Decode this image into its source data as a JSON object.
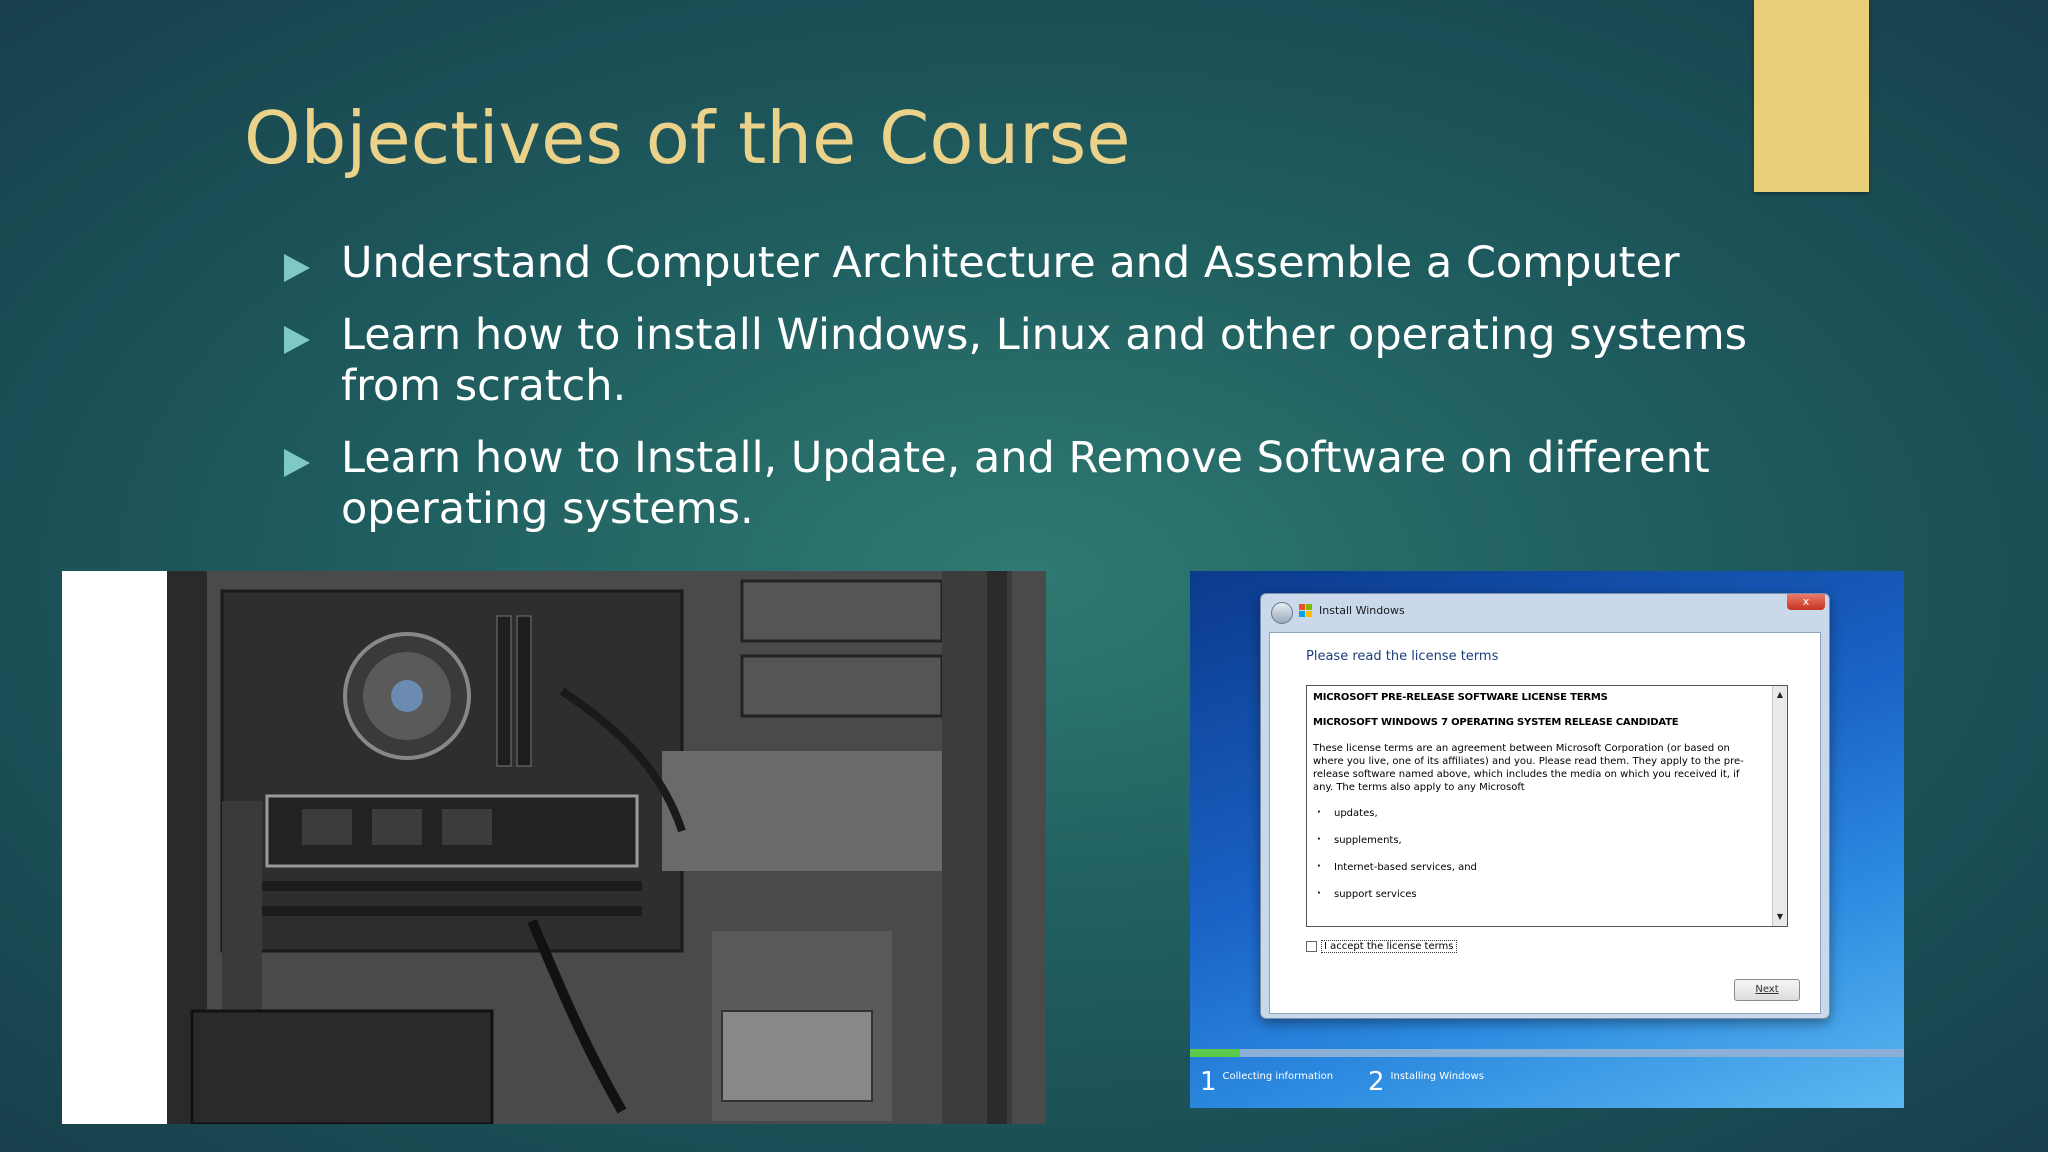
{
  "slide": {
    "title": "Objectives of the Course",
    "bullets": [
      "Understand Computer Architecture and Assemble a Computer",
      "Learn how to install Windows, Linux and other operating systems from scratch.",
      "Learn how to Install, Update, and Remove Software on different operating systems."
    ],
    "colors": {
      "title": "#ead28a",
      "accent": "#e9cf77",
      "bullet_arrow": "#7fc8c8"
    }
  },
  "installer": {
    "window_title": "Install Windows",
    "close_glyph": "x",
    "heading": "Please read the license terms",
    "license": {
      "heading1": "MICROSOFT PRE-RELEASE SOFTWARE LICENSE TERMS",
      "heading2": "MICROSOFT WINDOWS 7 OPERATING SYSTEM RELEASE CANDIDATE",
      "paragraph": "These license terms are an agreement between Microsoft Corporation (or based on where you live, one of its affiliates) and you. Please read them. They apply to the pre-release software named above, which includes the media on which you received it, if any. The terms also apply to any Microsoft",
      "items": [
        "updates,",
        "supplements,",
        "Internet-based services, and",
        "support services"
      ]
    },
    "scroll_up_glyph": "▲",
    "scroll_down_glyph": "▼",
    "accept_label": "I accept the license terms",
    "next_label": "Next",
    "progress_fraction": 0.07,
    "steps": [
      {
        "number": "1",
        "label": "Collecting information"
      },
      {
        "number": "2",
        "label": "Installing Windows"
      }
    ]
  }
}
